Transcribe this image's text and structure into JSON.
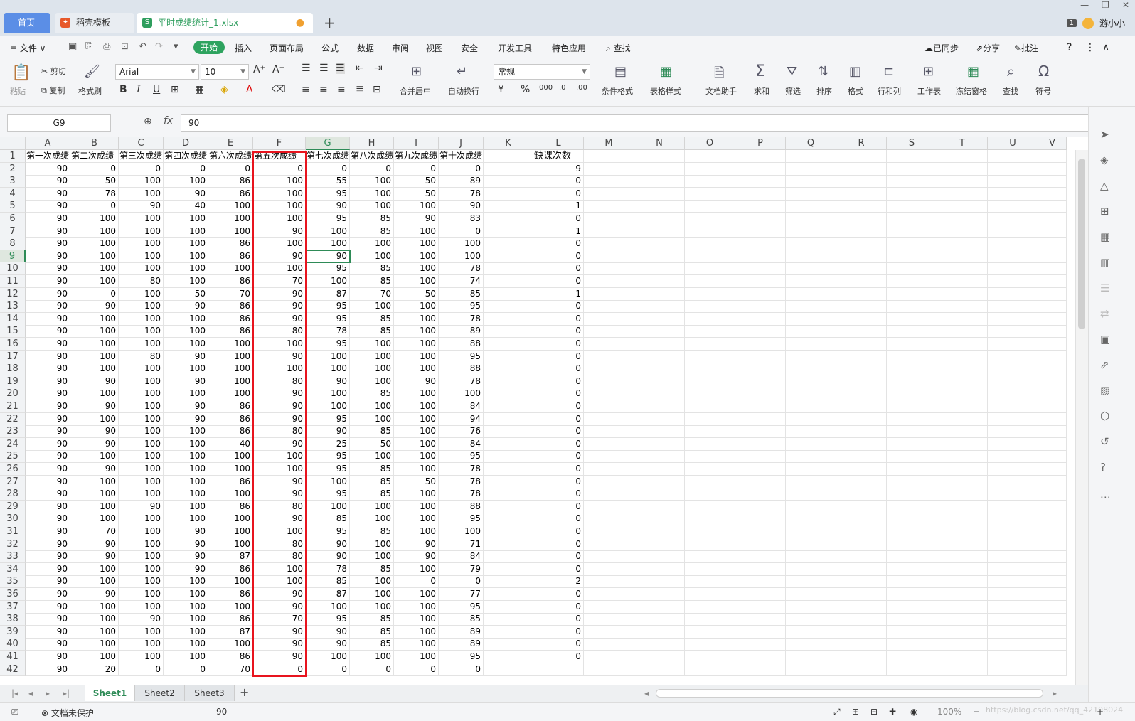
{
  "titlebar": {
    "tab_home": "首页",
    "tab_template": "稻壳模板",
    "tab_file": "平时成绩统计_1.xlsx",
    "file_icon": "S",
    "unsaved_dot": "●",
    "add_tab": "+",
    "win_minimize": "—",
    "win_restore": "❐",
    "win_close": "✕",
    "badge": "1",
    "user": "游小小"
  },
  "menubar": {
    "file": "≡ 文件 ∨",
    "items": [
      "开始",
      "插入",
      "页面布局",
      "公式",
      "数据",
      "审阅",
      "视图",
      "安全",
      "开发工具",
      "特色应用"
    ],
    "search": "查找",
    "sync": "已同步",
    "share": "分享",
    "comment": "批注",
    "help": "?",
    "more": "⋮",
    "collapse": "∧"
  },
  "ribbon": {
    "paste": "粘贴",
    "cut": "剪切",
    "copy": "复制",
    "format_painter": "格式刷",
    "font_name": "Arial",
    "font_size": "10",
    "number_format": "常规",
    "merge_center": "合并居中",
    "wrap_text": "自动换行",
    "cond_format": "条件格式",
    "table_style": "表格样式",
    "doc_assistant": "文档助手",
    "sum": "求和",
    "filter": "筛选",
    "sort": "排序",
    "format": "格式",
    "row_col": "行和列",
    "worksheet": "工作表",
    "freeze": "冻结窗格",
    "find": "查找",
    "symbol": "符号"
  },
  "formula_bar": {
    "name_box": "G9",
    "fx": "fx",
    "value": "90"
  },
  "columns": [
    "A",
    "B",
    "C",
    "D",
    "E",
    "F",
    "G",
    "H",
    "I",
    "J",
    "K",
    "L",
    "M",
    "N",
    "O",
    "P",
    "Q",
    "R",
    "S",
    "T",
    "U",
    "V"
  ],
  "header_row": [
    "第一次成绩",
    "第二次成绩",
    "第三次成绩",
    "第四次成绩",
    "第六次成绩",
    "第五次成绩",
    "第七次成绩",
    "第八次成绩",
    "第九次成绩",
    "第十次成绩",
    "",
    "缺课次数"
  ],
  "rows": [
    [
      90,
      0,
      0,
      0,
      0,
      0,
      0,
      0,
      0,
      0,
      "",
      9
    ],
    [
      90,
      50,
      100,
      100,
      86,
      100,
      55,
      100,
      50,
      89,
      "",
      0
    ],
    [
      90,
      78,
      100,
      90,
      86,
      100,
      95,
      100,
      50,
      78,
      "",
      0
    ],
    [
      90,
      0,
      90,
      40,
      100,
      100,
      90,
      100,
      100,
      90,
      "",
      1
    ],
    [
      90,
      100,
      100,
      100,
      100,
      100,
      95,
      85,
      90,
      83,
      "",
      0
    ],
    [
      90,
      100,
      100,
      100,
      100,
      90,
      100,
      85,
      100,
      0,
      "",
      1
    ],
    [
      90,
      100,
      100,
      100,
      86,
      100,
      100,
      100,
      100,
      100,
      "",
      0
    ],
    [
      90,
      100,
      100,
      100,
      86,
      90,
      90,
      100,
      100,
      100,
      "",
      0
    ],
    [
      90,
      100,
      100,
      100,
      100,
      100,
      95,
      85,
      100,
      78,
      "",
      0
    ],
    [
      90,
      100,
      80,
      100,
      86,
      70,
      100,
      85,
      100,
      74,
      "",
      0
    ],
    [
      90,
      0,
      100,
      50,
      70,
      90,
      87,
      70,
      50,
      85,
      "",
      1
    ],
    [
      90,
      90,
      100,
      90,
      86,
      90,
      95,
      100,
      100,
      95,
      "",
      0
    ],
    [
      90,
      100,
      100,
      100,
      86,
      90,
      95,
      85,
      100,
      78,
      "",
      0
    ],
    [
      90,
      100,
      100,
      100,
      86,
      80,
      78,
      85,
      100,
      89,
      "",
      0
    ],
    [
      90,
      100,
      100,
      100,
      100,
      100,
      95,
      100,
      100,
      88,
      "",
      0
    ],
    [
      90,
      100,
      80,
      90,
      100,
      90,
      100,
      100,
      100,
      95,
      "",
      0
    ],
    [
      90,
      100,
      100,
      100,
      100,
      100,
      100,
      100,
      100,
      88,
      "",
      0
    ],
    [
      90,
      90,
      100,
      90,
      100,
      80,
      90,
      100,
      90,
      78,
      "",
      0
    ],
    [
      90,
      100,
      100,
      100,
      100,
      90,
      100,
      85,
      100,
      100,
      "",
      0
    ],
    [
      90,
      90,
      100,
      90,
      86,
      90,
      100,
      100,
      100,
      84,
      "",
      0
    ],
    [
      90,
      100,
      100,
      90,
      86,
      90,
      95,
      100,
      100,
      94,
      "",
      0
    ],
    [
      90,
      90,
      100,
      100,
      86,
      80,
      90,
      85,
      100,
      76,
      "",
      0
    ],
    [
      90,
      90,
      100,
      100,
      40,
      90,
      25,
      50,
      100,
      84,
      "",
      0
    ],
    [
      90,
      100,
      100,
      100,
      100,
      100,
      95,
      100,
      100,
      95,
      "",
      0
    ],
    [
      90,
      90,
      100,
      100,
      100,
      100,
      95,
      85,
      100,
      78,
      "",
      0
    ],
    [
      90,
      100,
      100,
      100,
      86,
      90,
      100,
      85,
      50,
      78,
      "",
      0
    ],
    [
      90,
      100,
      100,
      100,
      100,
      90,
      95,
      85,
      100,
      78,
      "",
      0
    ],
    [
      90,
      100,
      90,
      100,
      86,
      80,
      100,
      100,
      100,
      88,
      "",
      0
    ],
    [
      90,
      100,
      100,
      100,
      100,
      90,
      85,
      100,
      100,
      95,
      "",
      0
    ],
    [
      90,
      70,
      100,
      90,
      100,
      100,
      95,
      85,
      100,
      100,
      "",
      0
    ],
    [
      90,
      90,
      100,
      90,
      100,
      80,
      90,
      100,
      90,
      71,
      "",
      0
    ],
    [
      90,
      90,
      100,
      90,
      87,
      80,
      90,
      100,
      90,
      84,
      "",
      0
    ],
    [
      90,
      100,
      100,
      90,
      86,
      100,
      78,
      85,
      100,
      79,
      "",
      0
    ],
    [
      90,
      100,
      100,
      100,
      100,
      100,
      85,
      100,
      0,
      0,
      "",
      2
    ],
    [
      90,
      90,
      100,
      100,
      86,
      90,
      87,
      100,
      100,
      77,
      "",
      0
    ],
    [
      90,
      100,
      100,
      100,
      100,
      90,
      100,
      100,
      100,
      95,
      "",
      0
    ],
    [
      90,
      100,
      90,
      100,
      86,
      70,
      95,
      85,
      100,
      85,
      "",
      0
    ],
    [
      90,
      100,
      100,
      100,
      87,
      90,
      90,
      85,
      100,
      89,
      "",
      0
    ],
    [
      90,
      100,
      100,
      100,
      100,
      90,
      90,
      85,
      100,
      89,
      "",
      0
    ],
    [
      90,
      100,
      100,
      100,
      86,
      90,
      100,
      100,
      100,
      95,
      "",
      0
    ],
    [
      90,
      20,
      0,
      0,
      70,
      0,
      0,
      0,
      0,
      0,
      "",
      ""
    ]
  ],
  "selected": {
    "row": 9,
    "col": "G"
  },
  "sheets": [
    "Sheet1",
    "Sheet2",
    "Sheet3"
  ],
  "active_sheet": "Sheet1",
  "add_sheet": "+",
  "statusbar": {
    "protect": "文档未保护",
    "value": "90",
    "zoom": "100%",
    "watermark": "https://blog.csdn.net/qq_42198024"
  },
  "colors": {
    "accent": "#2e8b57",
    "highlight_box": "#e8141e",
    "tab_home": "#5b8ee6"
  }
}
